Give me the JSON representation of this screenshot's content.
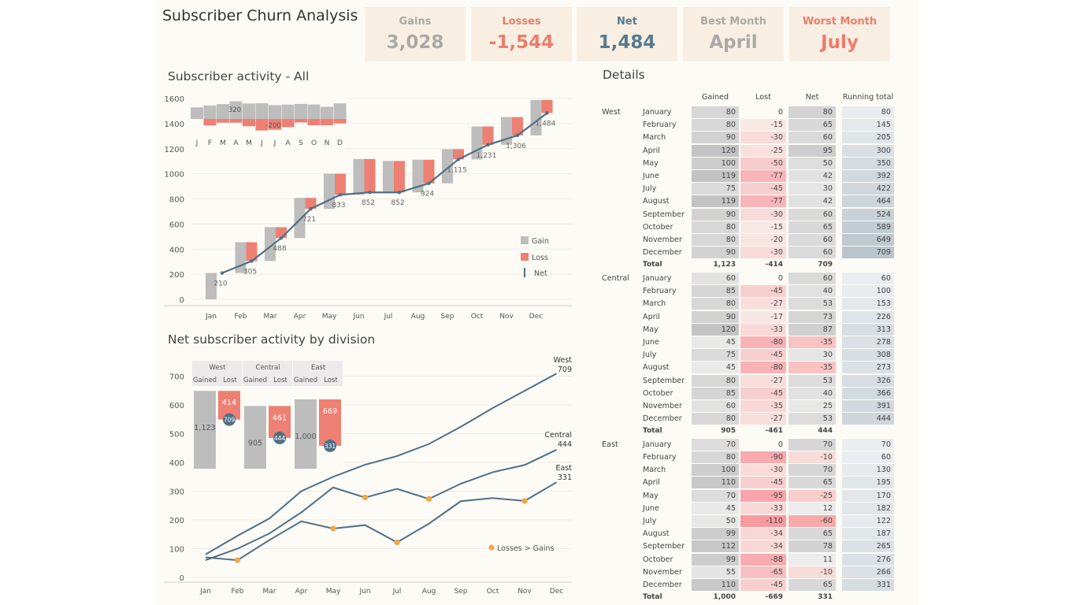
{
  "header": {
    "title": "Subscriber Churn Analysis"
  },
  "kpis": [
    {
      "label": "Gains",
      "value": "3,028",
      "color": "#a9a9a9"
    },
    {
      "label": "Losses",
      "value": "-1,544",
      "color": "#ee7c6b"
    },
    {
      "label": "Net",
      "value": "1,484",
      "color": "#587a8e"
    },
    {
      "label": "Best Month",
      "value": "April",
      "color": "#a9a9a9"
    },
    {
      "label": "Worst Month",
      "value": "July",
      "color": "#ee7c6b"
    }
  ],
  "waterfall": {
    "title": "Subscriber activity  - All",
    "months": [
      "Jan",
      "Feb",
      "Mar",
      "Apr",
      "May",
      "Jun",
      "Jul",
      "Aug",
      "Sep",
      "Oct",
      "Nov",
      "Dec"
    ],
    "gained": [
      210,
      245,
      270,
      320,
      280,
      285,
      250,
      260,
      272,
      262,
      221,
      282
    ],
    "lost": [
      0,
      -150,
      -87,
      -87,
      -168,
      -266,
      -250,
      -189,
      -81,
      -146,
      -146,
      -104
    ],
    "net": [
      210,
      305,
      488,
      721,
      833,
      852,
      852,
      924,
      1115,
      1231,
      1306,
      1484
    ],
    "net_labels": [
      "210",
      "305",
      "488",
      "721",
      "833",
      "852",
      "852",
      "924",
      "1,115",
      "1,231",
      "1,306",
      "1,484"
    ],
    "yticks": [
      0,
      200,
      400,
      600,
      800,
      1000,
      1200,
      1400,
      1600
    ],
    "legend": [
      "Gain",
      "Loss",
      "Net"
    ],
    "inset_months": [
      "J",
      "F",
      "M",
      "A",
      "M",
      "J",
      "J",
      "A",
      "S",
      "O",
      "N",
      "D"
    ],
    "inset_gain_label": "320",
    "inset_loss_label": "-200"
  },
  "division_chart": {
    "title": "Net subscriber activity by division",
    "months": [
      "Jan",
      "Feb",
      "Mar",
      "Apr",
      "May",
      "Jun",
      "Jul",
      "Aug",
      "Sep",
      "Oct",
      "Nov",
      "Dec"
    ],
    "yticks": [
      0,
      100,
      200,
      300,
      400,
      500,
      600,
      700
    ],
    "series": [
      {
        "name": "West",
        "end_label": "709",
        "values": [
          80,
          145,
          205,
          300,
          350,
          392,
          422,
          464,
          524,
          589,
          649,
          709
        ]
      },
      {
        "name": "Central",
        "end_label": "444",
        "values": [
          60,
          100,
          153,
          226,
          313,
          278,
          308,
          273,
          326,
          366,
          391,
          444
        ]
      },
      {
        "name": "East",
        "end_label": "331",
        "values": [
          70,
          60,
          130,
          195,
          170,
          182,
          122,
          187,
          265,
          276,
          266,
          331
        ]
      }
    ],
    "legend_label": "Losses > Gains",
    "inset": {
      "divisions": [
        {
          "name": "West",
          "gained": 1123,
          "lost": 414,
          "net": 709,
          "gained_label": "1,123",
          "lost_label": "414",
          "net_label": "709"
        },
        {
          "name": "Central",
          "gained": 905,
          "lost": 461,
          "net": 444,
          "gained_label": "905",
          "lost_label": "461",
          "net_label": "444"
        },
        {
          "name": "East",
          "gained": 1000,
          "lost": 669,
          "net": 331,
          "gained_label": "1,000",
          "lost_label": "669",
          "net_label": "331"
        }
      ],
      "col_gained": "Gained",
      "col_lost": "Lost"
    }
  },
  "details": {
    "title": "Details",
    "columns": [
      "Gained",
      "Lost",
      "Net",
      "Running total"
    ],
    "total_label": "Total",
    "divisions": [
      {
        "name": "West",
        "rows": [
          [
            "January",
            "80",
            "0",
            "80",
            "80"
          ],
          [
            "February",
            "80",
            "-15",
            "65",
            "145"
          ],
          [
            "March",
            "90",
            "-30",
            "60",
            "205"
          ],
          [
            "April",
            "120",
            "-25",
            "95",
            "300"
          ],
          [
            "May",
            "100",
            "-50",
            "50",
            "350"
          ],
          [
            "June",
            "119",
            "-77",
            "42",
            "392"
          ],
          [
            "July",
            "75",
            "-45",
            "30",
            "422"
          ],
          [
            "August",
            "119",
            "-77",
            "42",
            "464"
          ],
          [
            "September",
            "90",
            "-30",
            "60",
            "524"
          ],
          [
            "October",
            "80",
            "-15",
            "65",
            "589"
          ],
          [
            "November",
            "80",
            "-20",
            "60",
            "649"
          ],
          [
            "December",
            "90",
            "-30",
            "60",
            "709"
          ]
        ],
        "total": [
          "1,123",
          "-414",
          "709"
        ]
      },
      {
        "name": "Central",
        "rows": [
          [
            "January",
            "60",
            "0",
            "60",
            "60"
          ],
          [
            "February",
            "85",
            "-45",
            "40",
            "100"
          ],
          [
            "March",
            "80",
            "-27",
            "53",
            "153"
          ],
          [
            "April",
            "90",
            "-17",
            "73",
            "226"
          ],
          [
            "May",
            "120",
            "-33",
            "87",
            "313"
          ],
          [
            "June",
            "45",
            "-80",
            "-35",
            "278"
          ],
          [
            "July",
            "75",
            "-45",
            "30",
            "308"
          ],
          [
            "August",
            "45",
            "-80",
            "-35",
            "273"
          ],
          [
            "September",
            "80",
            "-27",
            "53",
            "326"
          ],
          [
            "October",
            "85",
            "-45",
            "40",
            "366"
          ],
          [
            "November",
            "60",
            "-35",
            "25",
            "391"
          ],
          [
            "December",
            "80",
            "-27",
            "53",
            "444"
          ]
        ],
        "total": [
          "905",
          "-461",
          "444"
        ]
      },
      {
        "name": "East",
        "rows": [
          [
            "January",
            "70",
            "0",
            "70",
            "70"
          ],
          [
            "February",
            "80",
            "-90",
            "-10",
            "60"
          ],
          [
            "March",
            "100",
            "-30",
            "70",
            "130"
          ],
          [
            "April",
            "110",
            "-45",
            "65",
            "195"
          ],
          [
            "May",
            "70",
            "-95",
            "-25",
            "170"
          ],
          [
            "June",
            "45",
            "-33",
            "12",
            "182"
          ],
          [
            "July",
            "50",
            "-110",
            "-60",
            "122"
          ],
          [
            "August",
            "99",
            "-34",
            "65",
            "187"
          ],
          [
            "September",
            "112",
            "-34",
            "78",
            "265"
          ],
          [
            "October",
            "99",
            "-88",
            "11",
            "276"
          ],
          [
            "November",
            "55",
            "-65",
            "-10",
            "266"
          ],
          [
            "December",
            "110",
            "-45",
            "65",
            "331"
          ]
        ],
        "total": [
          "1,000",
          "-669",
          "331"
        ]
      }
    ]
  },
  "colors": {
    "gain": "#bdbdbd",
    "loss": "#ee8073",
    "net": "#4f6f85",
    "dot": "#f2a64a",
    "panel": "#fcfbf6",
    "kpi_bg": "#f8efe2"
  }
}
